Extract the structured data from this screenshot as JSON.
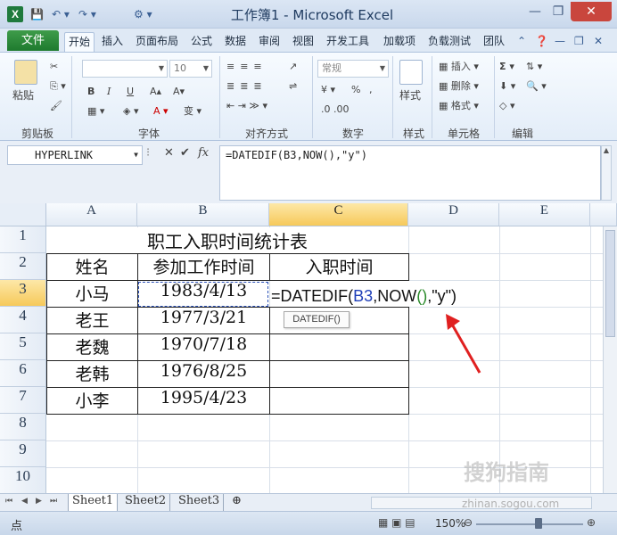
{
  "window": {
    "title": "工作簿1 - Microsoft Excel",
    "app_icon": "X",
    "accent_green": "#1e7a2e"
  },
  "quick_access": {
    "save": "💾",
    "undo": "↶ ▾",
    "redo": "↷ ▾",
    "customize": "⚙ ▾"
  },
  "tabs": {
    "file": "文件",
    "items": [
      "开始",
      "插入",
      "页面布局",
      "公式",
      "数据",
      "审阅",
      "视图",
      "开发工具",
      "加载项",
      "负载测试",
      "团队"
    ],
    "active": "开始"
  },
  "ribbon": {
    "groups": [
      "剪贴板",
      "字体",
      "对齐方式",
      "数字",
      "样式",
      "单元格",
      "编辑"
    ],
    "paste_label": "粘贴",
    "font_size": "10",
    "number_format": "常规",
    "style_label": "样式",
    "insert_label": "插入",
    "delete_label": "删除",
    "format_label": "格式",
    "bold": "B",
    "italic": "I",
    "underline": "U",
    "sum": "Σ",
    "percent": "%"
  },
  "formula_bar": {
    "name_box": "HYPERLINK",
    "fx": "fx",
    "formula": "=DATEDIF(B3,NOW(),\"y\")"
  },
  "columns": [
    "A",
    "B",
    "C",
    "D",
    "E"
  ],
  "rows": [
    "1",
    "2",
    "3",
    "4",
    "5",
    "6",
    "7",
    "8",
    "9",
    "10"
  ],
  "selected_column": "C",
  "selected_row": "3",
  "sheet": {
    "title": "职工入职时间统计表",
    "headers": [
      "姓名",
      "参加工作时间",
      "入职时间"
    ],
    "records": [
      {
        "name": "小马",
        "date": "1983/4/13"
      },
      {
        "name": "老王",
        "date": "1977/3/21"
      },
      {
        "name": "老魏",
        "date": "1970/7/18"
      },
      {
        "name": "老韩",
        "date": "1976/8/25"
      },
      {
        "name": "小李",
        "date": "1995/4/23"
      }
    ],
    "editing_formula": {
      "prefix": "=DATEDIF(",
      "ref": "B3",
      "mid": ",NOW",
      "parens": "()",
      "suffix": ",\"y\")"
    },
    "tooltip": "DATEDIF()"
  },
  "sheet_tabs": [
    "Sheet1",
    "Sheet2",
    "Sheet3"
  ],
  "active_sheet": "Sheet1",
  "status": {
    "mode": "点",
    "zoom": "150%"
  },
  "watermark": {
    "brand": "搜狗指南",
    "url": "zhinan.sogou.com"
  }
}
